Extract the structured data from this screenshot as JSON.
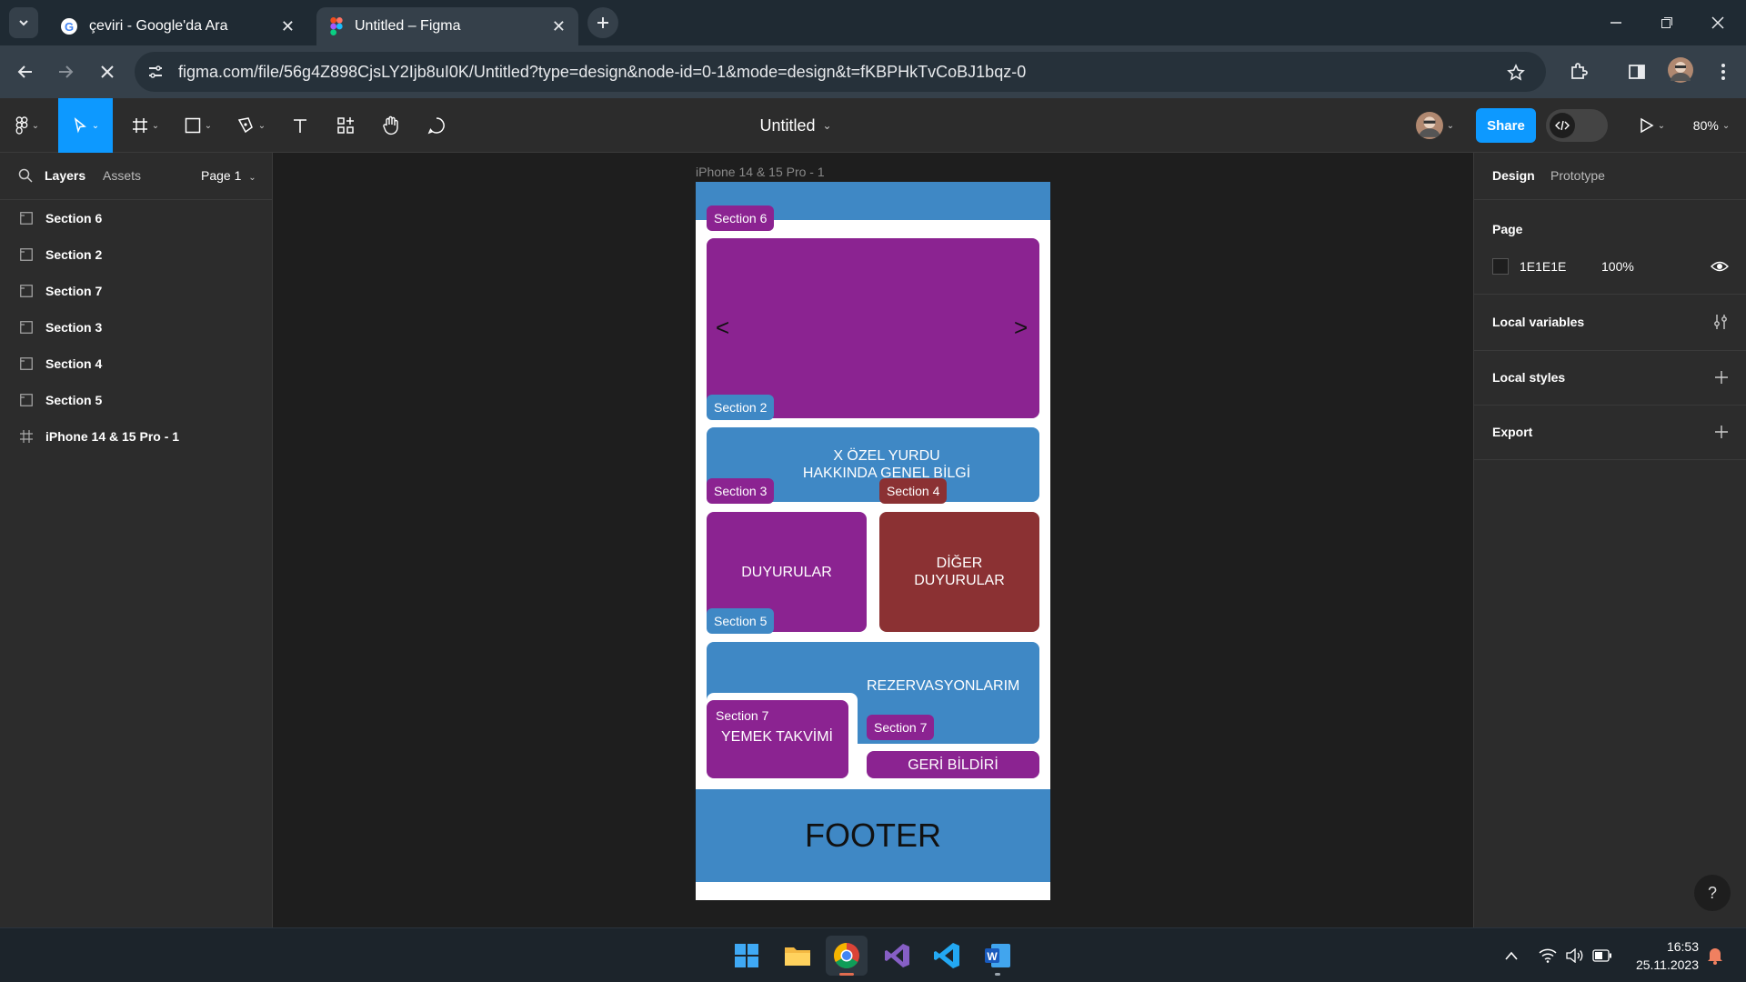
{
  "browser": {
    "tabs": [
      {
        "title": "çeviri - Google'da Ara",
        "favicon": "google-icon"
      },
      {
        "title": "Untitled – Figma",
        "favicon": "figma-icon"
      }
    ],
    "url": "figma.com/file/56g4Z898CjsLY2Ijb8uI0K/Untitled?type=design&node-id=0-1&mode=design&t=fKBPHkTvCoBJ1bqz-0"
  },
  "figma": {
    "file_name": "Untitled",
    "share_label": "Share",
    "zoom": "80%",
    "accent": "#0d99ff",
    "left_panel": {
      "tabs": [
        "Layers",
        "Assets"
      ],
      "page": "Page 1",
      "layers": [
        "Section 6",
        "Section 2",
        "Section 7",
        "Section 3",
        "Section 4",
        "Section 5",
        "iPhone 14 & 15 Pro - 1"
      ]
    },
    "right_panel": {
      "tabs": [
        "Design",
        "Prototype"
      ],
      "page_title": "Page",
      "page_color": "1E1E1E",
      "page_opacity": "100%",
      "local_variables": "Local variables",
      "local_styles": "Local styles",
      "export": "Export"
    },
    "canvas": {
      "frame_label": "iPhone 14 & 15 Pro - 1",
      "colors": {
        "purple": "#8b2391",
        "blue": "#3f88c5",
        "brown": "#8b3133"
      },
      "tags": {
        "section6": "Section 6",
        "section2": "Section 2",
        "section3": "Section 3",
        "section4": "Section 4",
        "section5": "Section 5",
        "section7a": "Section 7",
        "section7b": "Section 7"
      },
      "slider": {
        "prev": "<",
        "next": ">"
      },
      "blocks": {
        "info_line1": "X ÖZEL YURDU",
        "info_line2": "HAKKINDA GENEL BİLGİ",
        "announcements": "DUYURULAR",
        "other_line1": "DİĞER",
        "other_line2": "DUYURULAR",
        "reservations": "REZERVASYONLARIM",
        "meal": "YEMEK TAKVİMİ",
        "feedback": "GERİ BİLDİRİ",
        "footer": "FOOTER"
      }
    }
  },
  "taskbar": {
    "time": "16:53",
    "date": "25.11.2023"
  }
}
